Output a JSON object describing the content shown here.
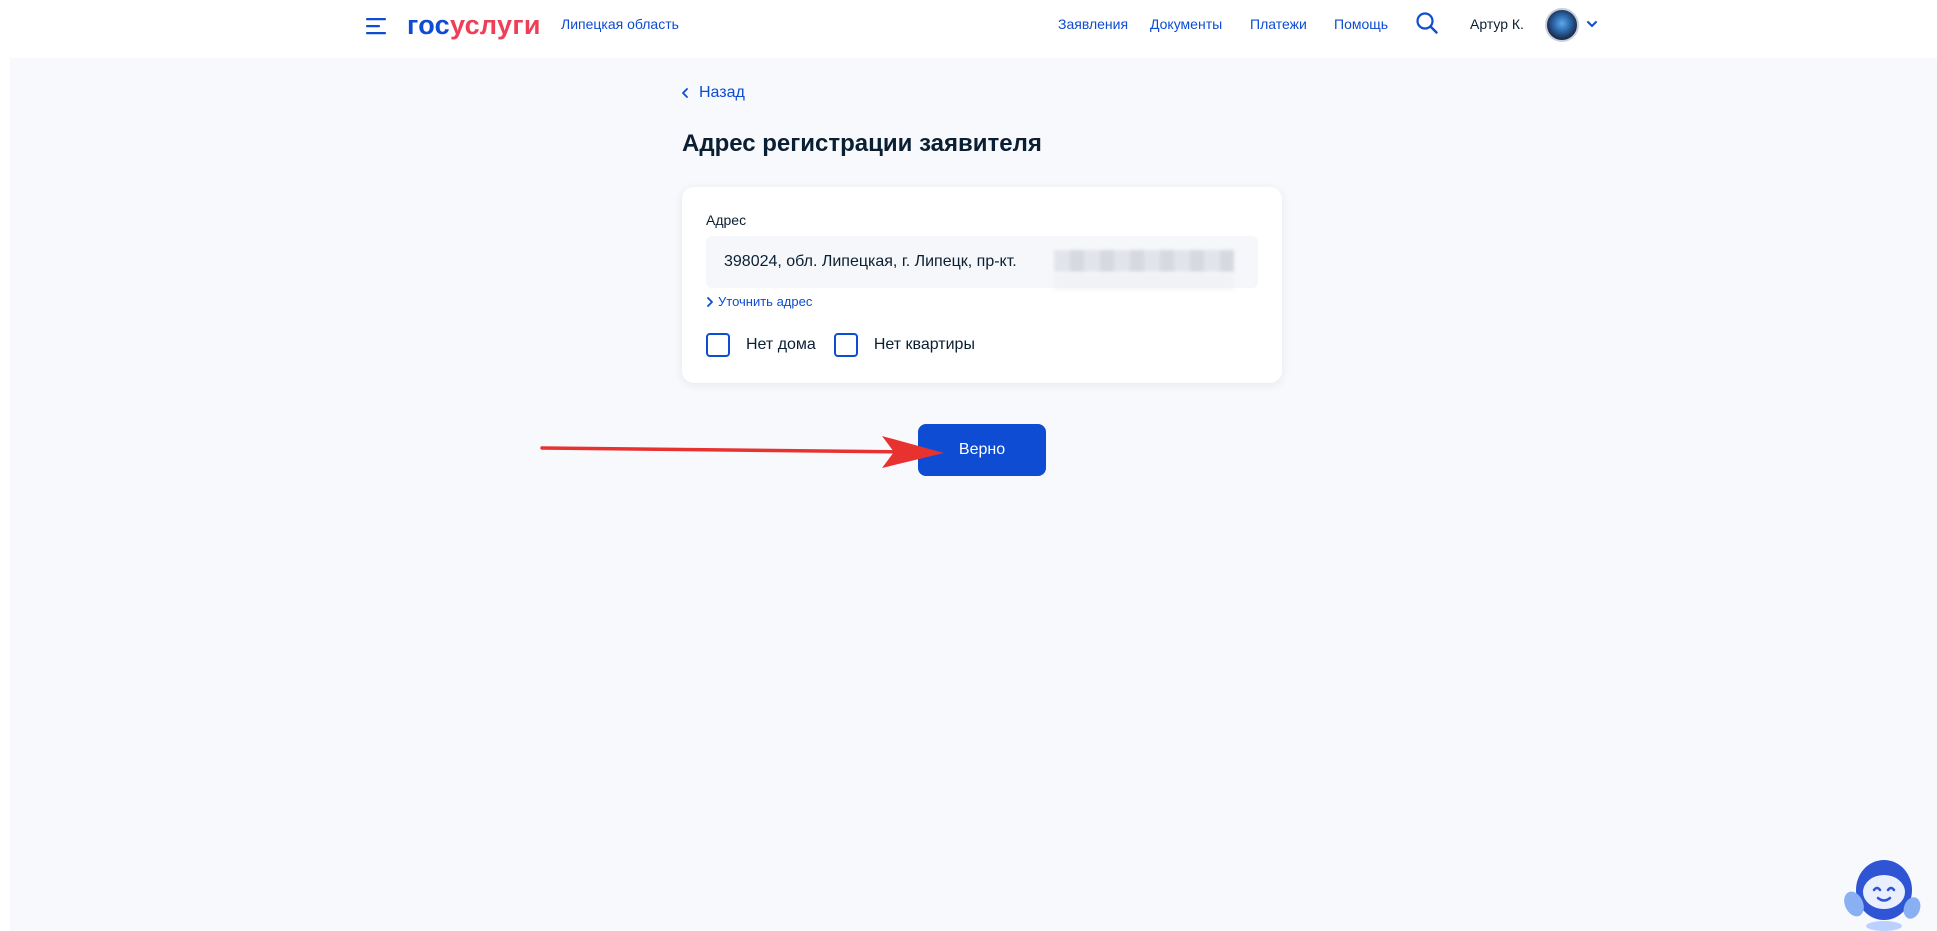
{
  "header": {
    "logo_part1": "гос",
    "logo_part2": "услуги",
    "region": "Липецкая область",
    "nav": [
      "Заявления",
      "Документы",
      "Платежи",
      "Помощь"
    ],
    "user_name": "Артур К."
  },
  "back_label": "Назад",
  "page_title": "Адрес регистрации заявителя",
  "address": {
    "label": "Адрес",
    "value": "398024, обл. Липецкая, г. Липецк, пр-кт.",
    "refine_link": "Уточнить адрес"
  },
  "checkboxes": [
    {
      "label": "Нет дома",
      "checked": false
    },
    {
      "label": "Нет квартиры",
      "checked": false
    }
  ],
  "confirm_button": "Верно",
  "colors": {
    "brand_blue": "#0d4cd3",
    "brand_red": "#ee3f58",
    "annotation_arrow": "#e8322f"
  },
  "icons": [
    "menu-icon",
    "search-icon",
    "chevron-down-icon",
    "chevron-left-icon",
    "chevron-right-icon",
    "assistant-robot-icon"
  ]
}
